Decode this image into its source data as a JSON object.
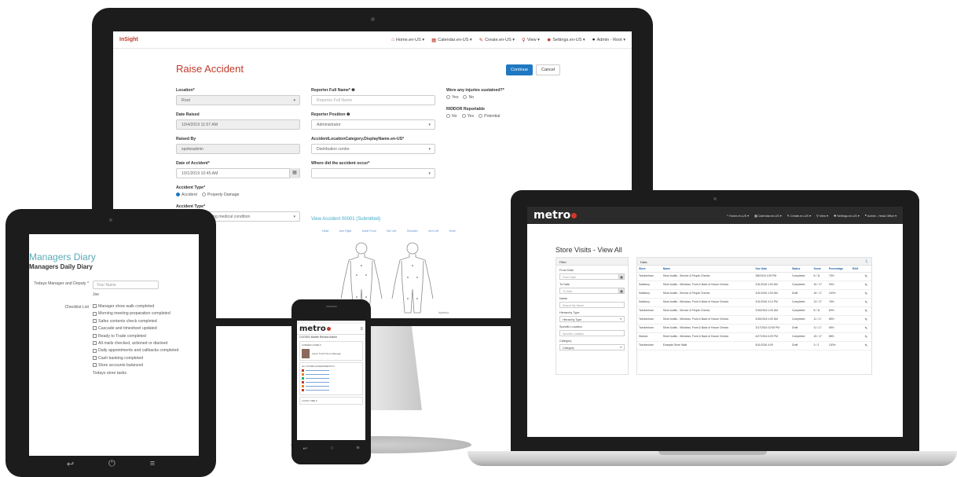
{
  "desktop": {
    "brand": "InSight",
    "nav": [
      {
        "icon": "home-icon",
        "label": "Home.en-US ▾"
      },
      {
        "icon": "calendar-icon",
        "label": "Calendar.en-US ▾"
      },
      {
        "icon": "pencil-icon",
        "label": "Create.en-US ▾"
      },
      {
        "icon": "search-icon",
        "label": "View ▾"
      },
      {
        "icon": "gear-icon",
        "label": "Settings.en-US ▾"
      },
      {
        "icon": "user-icon",
        "label": "Admin - Root ▾"
      }
    ],
    "title": "Raise Accident",
    "continue_label": "Continue",
    "cancel_label": "Cancel",
    "location_label": "Location*",
    "location_value": "Root",
    "date_raised_label": "Date Raised",
    "date_raised_value": "10/4/2019 11:57 AM",
    "raised_by_label": "Raised By",
    "raised_by_value": "spokeadmin",
    "date_accident_label": "Date of Accident*",
    "date_accident_value": "10/1/2019 10:45 AM",
    "accident_type_label": "Accident Type*",
    "accident_type_options": [
      "Accident",
      "Property Damage"
    ],
    "accident_type2_label": "Accident Type*",
    "accident_type2_value": "Already pre-existing medical condition",
    "reporter_name_label": "Reporter Full Name* ❶",
    "reporter_name_placeholder": "Reporter Full Name",
    "reporter_position_label": "Reporter Position ❶",
    "reporter_position_value": "Administrator",
    "loc_category_label": "AccidentLocationCategory.DisplayName.en-US*",
    "loc_category_value": "Distribution centre",
    "where_label": "Where did the accident occur*",
    "where_value": "",
    "injuries_label": "Were any injuries sustained?*",
    "injuries_options": [
      "Yes",
      "No"
    ],
    "riddor_label": "RIDDOR Reportable",
    "riddor_options": [
      "No",
      "Yes",
      "Potential"
    ],
    "view_link": "View Accident 00001 (Submitted)",
    "body_legend": [
      "Head",
      "Arm Right",
      "Ankle Front",
      "Ear Left",
      "Shoulder",
      "Arm Left",
      "Knee"
    ],
    "body_right_label": "Injured ▸"
  },
  "tablet": {
    "title": "Managers Diary",
    "subtitle": "Managers Daily Diary",
    "manager_label": "Todays Manager and Deputy *",
    "manager_placeholder": "Your Name",
    "manager_value": "Joe",
    "checklist_label": "Checklist List",
    "checklist": [
      "Manager show walk completed",
      "Morning meeting preparation completed",
      "Safes contents check completed",
      "Cascade and timesheet updated",
      "Ready to Trade completed",
      "All mails checked, actioned or diarised",
      "Daily appointments and callbacks completed",
      "Cash banking completed",
      "Store accounts balanced",
      "Todays store tasks"
    ]
  },
  "phone": {
    "logo": "metro",
    "brand_row": "COGSIS  Mobile Review Admin",
    "section1": "CAREER HOME ▾",
    "profile": "Aaron Smith  Store Manager",
    "section2": "ALL STORE ASSESSMENTS ▾",
    "section3": "LOGIN TIME ▾"
  },
  "laptop": {
    "logo": "metro",
    "nav": [
      {
        "icon": "home-icon",
        "label": "Home.en-US ▾"
      },
      {
        "icon": "calendar-icon",
        "label": "Calendar.en-US ▾"
      },
      {
        "icon": "pencil-icon",
        "label": "Create.en-US ▾"
      },
      {
        "icon": "search-icon",
        "label": "View ▾"
      },
      {
        "icon": "gear-icon",
        "label": "Settings.en-US ▾"
      },
      {
        "icon": "user-icon",
        "label": "Admin - Head Office ▾"
      }
    ],
    "title": "Store Visits - View All",
    "filter_head": "Filter",
    "filters": [
      {
        "label": "From Date",
        "placeholder": "From Date",
        "kind": "date"
      },
      {
        "label": "To Date",
        "placeholder": "To Date",
        "kind": "date"
      },
      {
        "label": "Name",
        "placeholder": "Search By Name",
        "kind": "text"
      },
      {
        "label": "Hierarchy Type",
        "placeholder": "Hierarchy Type",
        "kind": "select"
      },
      {
        "label": "Specific Location",
        "placeholder": "Specific Location",
        "kind": "text"
      },
      {
        "label": "Category",
        "placeholder": "Category",
        "kind": "select"
      }
    ],
    "data_head": "Data",
    "columns": [
      "Store",
      "Name",
      "Due Date",
      "Status",
      "Score",
      "Percentage",
      "RAG",
      ""
    ],
    "rows": [
      [
        "Twickenham",
        "Store Audits - Service & People Checks",
        "3/8/2016 1:09 PM",
        "Completed",
        "8 / 11",
        "73%",
        "",
        "✎"
      ],
      [
        "Salisbury",
        "Store Audits - Windows, Front & Back of House Checks",
        "3/11/2016 1:00 AM",
        "Completed",
        "16 / 17",
        "94%",
        "",
        "✎"
      ],
      [
        "Salisbury",
        "Store Audits - Service & People Checks",
        "3/11/2016 1:00 AM",
        "Draft",
        "16 / 17",
        "100%",
        "",
        "✎"
      ],
      [
        "Salisbury",
        "Store Audits - Windows, Front & Back of House Checks",
        "3/11/2016 4:14 PM",
        "Completed",
        "13 / 17",
        "76%",
        "",
        "✎"
      ],
      [
        "Twickenham",
        "Store Audits - Service & People Checks",
        "3/16/2016 1:00 AM",
        "Completed",
        "8 / 11",
        "60%",
        "",
        "✎"
      ],
      [
        "Twickenham",
        "Store Audits - Windows, Front & Back of House Checks",
        "3/16/2016 1:00 AM",
        "Completed",
        "11 / 17",
        "65%",
        "",
        "✎"
      ],
      [
        "Twickenham",
        "Store Audits - Windows, Front & Back of House Checks",
        "3/17/2016 12:55 PM",
        "Draft",
        "11 / 17",
        "65%",
        "",
        "✎"
      ],
      [
        "Staines",
        "Store Audits - Windows, Front & Back of House Checks",
        "4/27/2016 4:09 PM",
        "Completed",
        "15 / 17",
        "88%",
        "",
        "✎"
      ],
      [
        "Twickenham",
        "Example Store Walk",
        "5/11/2016 4:09",
        "Draft",
        "3 / 3",
        "100%",
        "",
        "✎"
      ]
    ]
  }
}
